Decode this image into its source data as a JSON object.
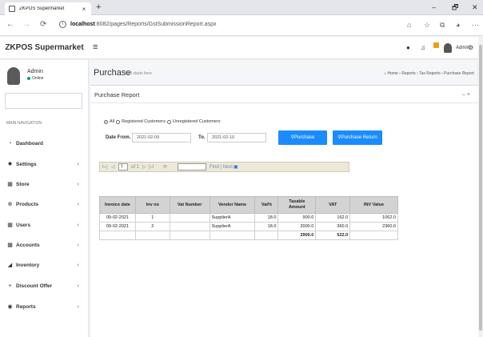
{
  "browser": {
    "tab_title": "ZKPOS Supermarket",
    "tab_close": "×",
    "new_tab": "+",
    "url_host": "localhost",
    "url_path": ":8082/pages/Reports/GstSubmissionReport.aspx",
    "window_minimize": "–",
    "window_restore": "🗗",
    "window_close": "✕"
  },
  "app": {
    "brand": "ZKPOS Supermarket",
    "header_user": "Admin"
  },
  "sidebar": {
    "user_name": "Admin",
    "user_status": "Online",
    "nav_header": "MAIN NAVIGATION",
    "items": [
      {
        "label": "Dashboard",
        "icon": "dashboard-icon",
        "glyph": "◔",
        "chevron": ""
      },
      {
        "label": "Settings",
        "icon": "settings-icon",
        "glyph": "✹",
        "chevron": "‹"
      },
      {
        "label": "Store",
        "icon": "store-icon",
        "glyph": "▦",
        "chevron": "‹"
      },
      {
        "label": "Products",
        "icon": "products-icon",
        "glyph": "⊕",
        "chevron": "‹"
      },
      {
        "label": "Users",
        "icon": "users-icon",
        "glyph": "▦",
        "chevron": "‹"
      },
      {
        "label": "Accounts",
        "icon": "accounts-icon",
        "glyph": "▦",
        "chevron": "‹"
      },
      {
        "label": "Inventory",
        "icon": "inventory-icon",
        "glyph": "◢",
        "chevron": "‹"
      },
      {
        "label": "Discount Offer",
        "icon": "plus-icon",
        "glyph": "+",
        "chevron": "‹"
      },
      {
        "label": "Reports",
        "icon": "reports-icon",
        "glyph": "◉",
        "chevron": "‹"
      }
    ]
  },
  "page": {
    "title": "Purchase",
    "subtitle": "it all starts here",
    "breadcrumb": "Home  ›  Reports  ›  Tax Reports  ›  Purchase Report"
  },
  "report": {
    "box_title": "Purchase Report",
    "box_tools": "–  ×",
    "radio_all": "All",
    "radio_registered": "Registered Customers",
    "radio_unregistered": "Unregistered Customers",
    "date_from_label": "Date From.",
    "date_from_value": "2021-02-09",
    "date_to_label": "To.",
    "date_to_value": "2021-02-10",
    "purchase_button": "Purchase",
    "purchase_return_button": "Purchase Return",
    "viewer": {
      "first": "I◁",
      "prev": "◁",
      "page_value": "1",
      "of_pages": "of 1",
      "next": "▷",
      "last": "▷I",
      "refresh": "⟳",
      "find_label": "Find | Next",
      "export_icon": "▣"
    },
    "columns": [
      "Invoice date",
      "Inv no",
      "Vat Number",
      "Vendor Name",
      "Vat%",
      "Taxable Amount",
      "VAT",
      "INV Value"
    ],
    "rows": [
      [
        "09-02-2021",
        "1",
        "",
        "SupplierA",
        "18.0",
        "900.0",
        "162.0",
        "1062.0"
      ],
      [
        "09-02-2021",
        "2",
        "",
        "SupplierA",
        "18.0",
        "2000.0",
        "360.0",
        "2360.0"
      ]
    ],
    "totals": {
      "taxable": "2900.0",
      "vat": "522.0"
    }
  },
  "colors": {
    "primary_button": "#1a8cff",
    "online": "#00a65a",
    "toolbar_bg": "#ece9d8",
    "table_header": "#d3d3d3"
  }
}
